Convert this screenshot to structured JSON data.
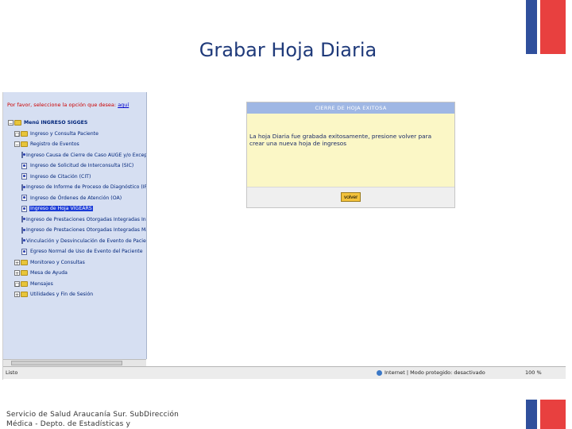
{
  "slide": {
    "title": "Grabar Hoja Diaria",
    "footer_line1": "Servicio de Salud Araucanía Sur. SubDirección",
    "footer_line2": "Médica - Depto. de Estadísticas y"
  },
  "sidebar": {
    "prompt_text": "Por favor, seleccione la opción que desea:",
    "prompt_link": "aquí",
    "tree": [
      {
        "label": "Menú INGRESO SIGGES",
        "expander": "−",
        "icon": "folder-icon"
      },
      {
        "label": "Ingreso y Consulta Paciente",
        "expander": "□",
        "icon": "folder-icon"
      },
      {
        "label": "Registro de Eventos",
        "expander": "−",
        "icon": "folder-icon"
      },
      {
        "label": "Ingreso Causa de Cierre de Caso AUGE y/o Excepción",
        "icon": "page-icon"
      },
      {
        "label": "Ingreso de Solicitud de Interconsulta (SIC)",
        "icon": "page-icon"
      },
      {
        "label": "Ingreso de Citación (CIT)",
        "icon": "page-icon"
      },
      {
        "label": "Ingreso de Informe de Proceso de Diagnóstico (IPD)",
        "icon": "page-icon"
      },
      {
        "label": "Ingreso de Órdenes de Atención (OA)",
        "icon": "page-icon"
      },
      {
        "label": "Ingreso de Hoja VIGEARS",
        "icon": "page-icon",
        "selected": true
      },
      {
        "label": "Ingreso de Prestaciones Otorgadas Integradas Individual",
        "icon": "page-icon"
      },
      {
        "label": "Ingreso de Prestaciones Otorgadas Integradas Masivo",
        "icon": "page-icon"
      },
      {
        "label": "Vinculación y Desvinculación de Evento de Pacientes",
        "icon": "page-icon"
      },
      {
        "label": "Egreso Normal de Uso de Evento del Paciente",
        "icon": "page-icon"
      },
      {
        "label": "Monitoreo y Consultas",
        "expander": "+",
        "icon": "folder-icon"
      },
      {
        "label": "Mesa de Ayuda",
        "expander": "+",
        "icon": "folder-icon"
      },
      {
        "label": "Mensajes",
        "expander": "□",
        "icon": "folder-icon"
      },
      {
        "label": "Utilidades y Fin de Sesión",
        "expander": "+",
        "icon": "folder-icon"
      }
    ]
  },
  "panel": {
    "header": "CIERRE DE HOJA EXITOSA",
    "message": "La hoja Diaria fue grabada exitosamente, presione volver para crear una nueva hoja de ingresos",
    "button_label": "volver"
  },
  "status_bar": {
    "left": "Listo",
    "zone": "Internet | Modo protegido: desactivado",
    "zoom": "100 %"
  },
  "colors": {
    "sidebar_bg": "#d6dff2",
    "panel_bg": "#fbf7c6",
    "panel_header": "#9fb7e4",
    "selected": "#1a3bd8",
    "flag_blue": "#2f4f9c",
    "flag_red": "#e8403f"
  }
}
